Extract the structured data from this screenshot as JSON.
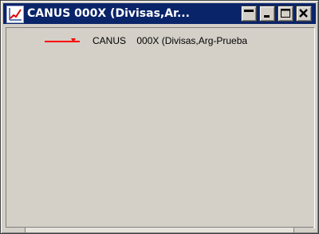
{
  "window": {
    "title": "CANUS    000X (Divisas,Ar...",
    "icon": "chart-icon",
    "title_bar_color": "#0a246a",
    "controls": [
      {
        "name": "restore-button",
        "glyph": "▀"
      },
      {
        "name": "minimize-button",
        "glyph": "▁"
      },
      {
        "name": "maximize-button",
        "glyph": "□"
      },
      {
        "name": "close-button",
        "glyph": "✕"
      }
    ]
  },
  "legend": {
    "label": "CANUS    000X (Divisas,Arg-Prueba",
    "series_color": "#ff0000"
  }
}
